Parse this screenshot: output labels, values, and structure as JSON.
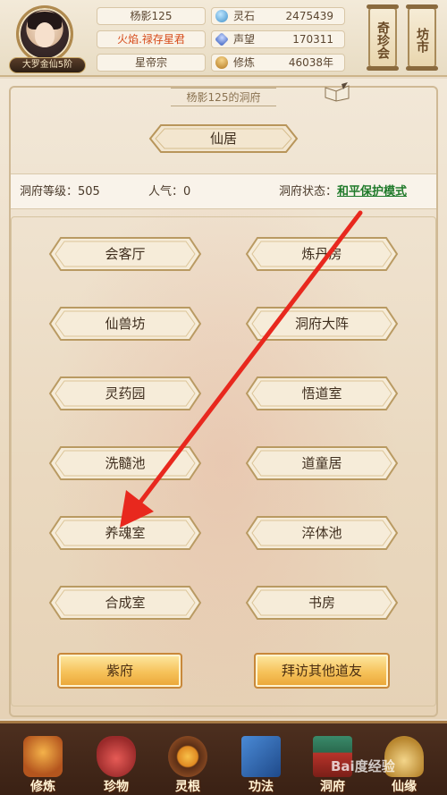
{
  "player": {
    "name": "杨影125",
    "title": "火焰.禄存星君",
    "sect": "星帝宗",
    "rank": "大罗金仙5阶"
  },
  "stats": [
    {
      "icon": "spirit-stone-icon",
      "label": "灵石",
      "value": "2475439",
      "color": "#5fa8d8"
    },
    {
      "icon": "prestige-icon",
      "label": "声望",
      "value": "170311",
      "color": "#4a74c9"
    },
    {
      "icon": "cultivation-icon",
      "label": "修炼",
      "value": "46038年",
      "color": "#d49b3a"
    }
  ],
  "side_buttons": {
    "treasure": "奇珍会",
    "market": "坊市"
  },
  "cave": {
    "title": "杨影125的洞府",
    "residence": "仙居",
    "level_label": "洞府等级：505",
    "popularity_label": "人气：0",
    "status_label": "洞府状态：",
    "status_value": "和平保护模式"
  },
  "rooms": [
    "会客厅",
    "炼丹房",
    "仙兽坊",
    "洞府大阵",
    "灵药园",
    "悟道室",
    "洗髓池",
    "道童居",
    "养魂室",
    "淬体池",
    "合成室",
    "书房"
  ],
  "actions": {
    "purple_mansion": "紫府",
    "visit_friends": "拜访其他道友"
  },
  "nav": [
    {
      "label": "修炼",
      "icon": "cultivate-nav-icon"
    },
    {
      "label": "珍物",
      "icon": "treasure-bag-nav-icon"
    },
    {
      "label": "灵根",
      "icon": "spirit-root-nav-icon"
    },
    {
      "label": "功法",
      "icon": "technique-nav-icon"
    },
    {
      "label": "洞府",
      "icon": "cave-nav-icon"
    },
    {
      "label": "仙缘",
      "icon": "fate-nav-icon"
    }
  ],
  "watermark": "Bai度经验",
  "colors": {
    "status_link": "#1f7a2a",
    "title_red": "#d64b1a",
    "arrow": "#e8281e"
  }
}
